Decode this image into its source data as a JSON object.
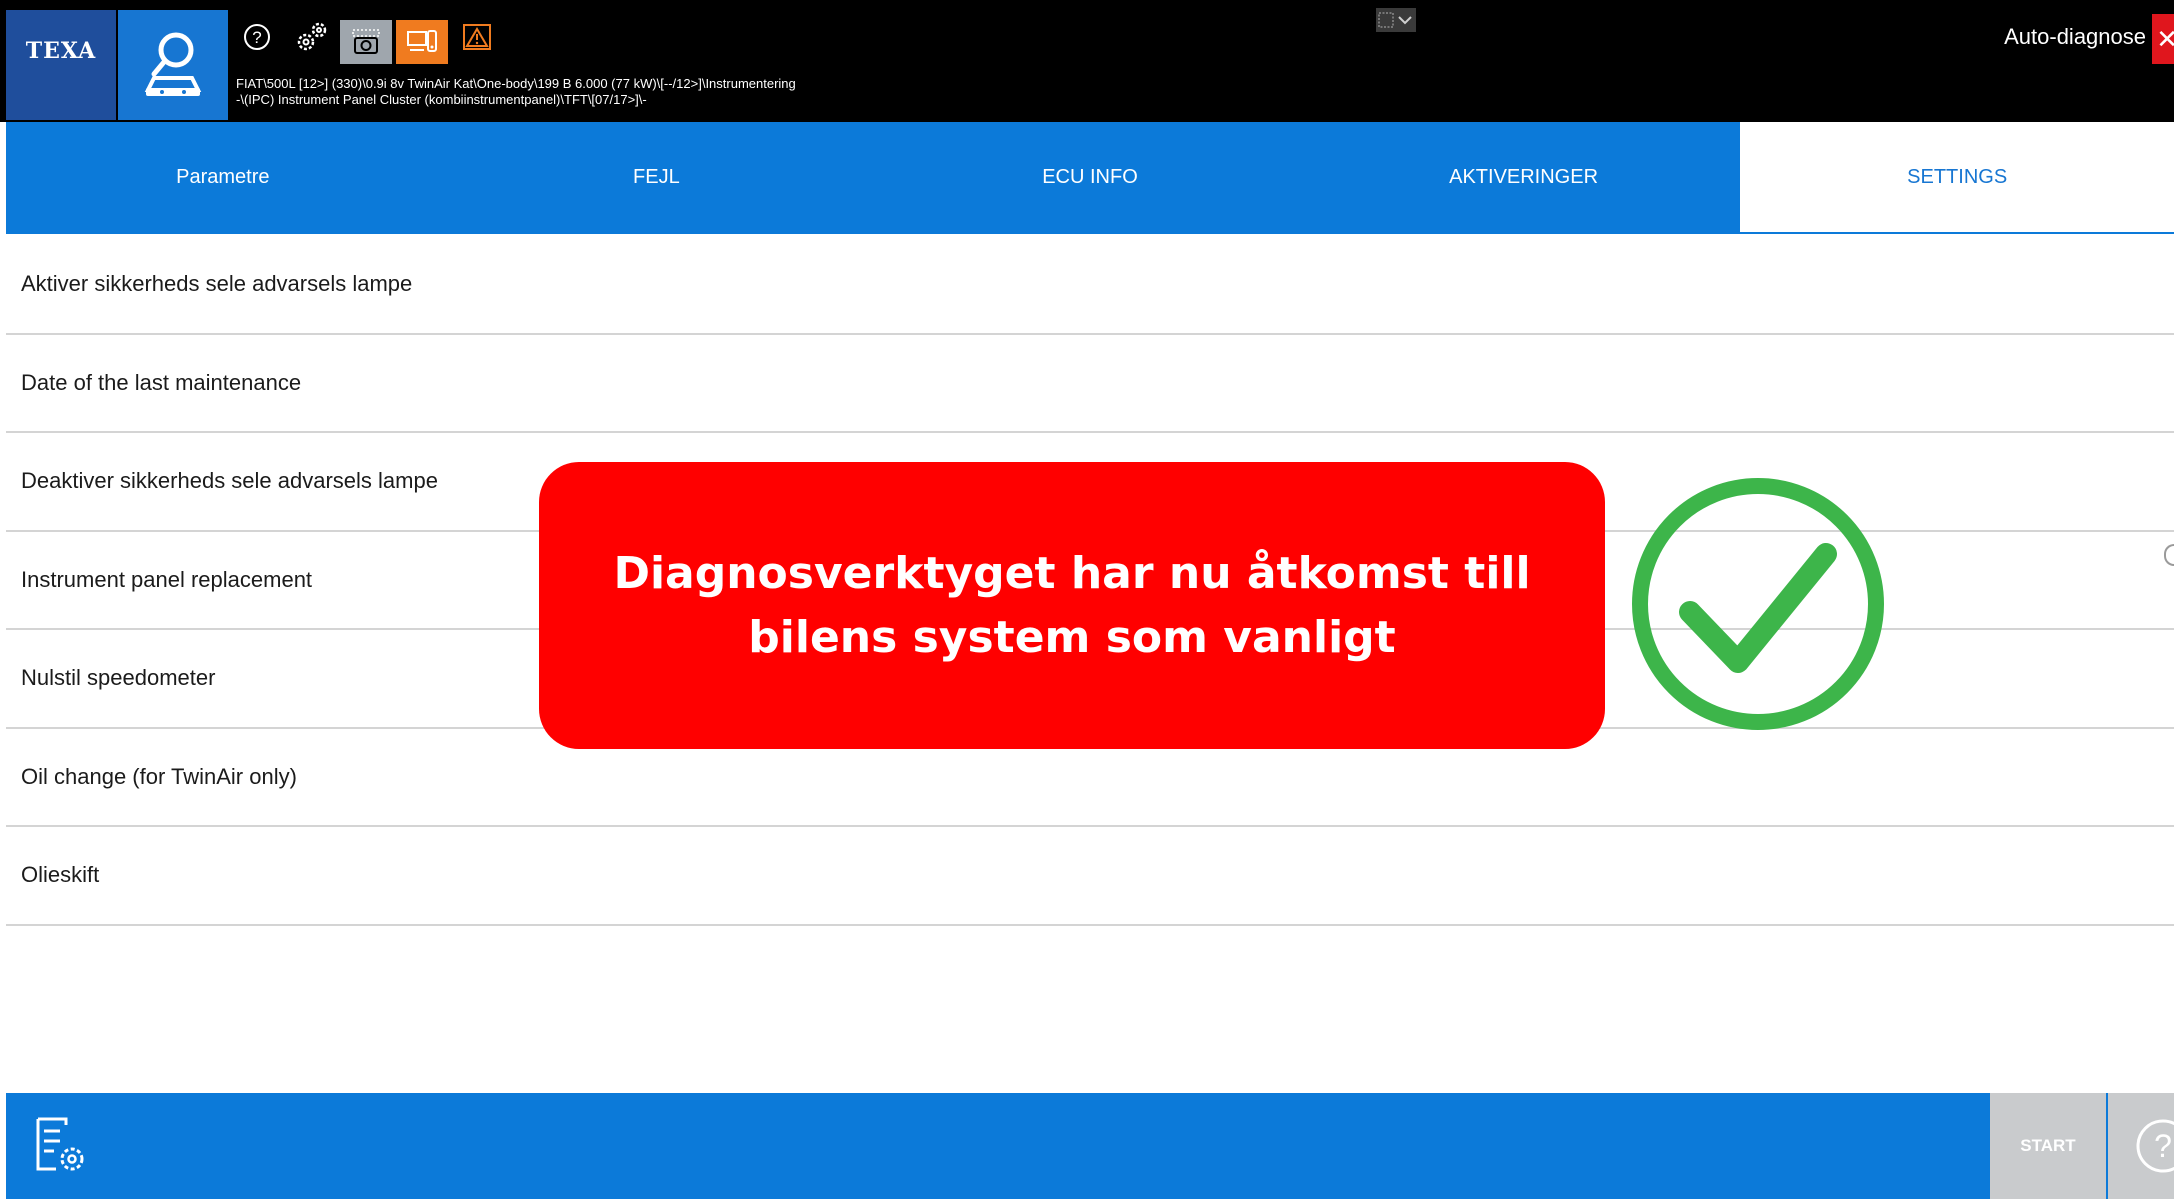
{
  "header": {
    "logo_text": "TEXA",
    "breadcrumb_line1": "FIAT\\500L [12>] (330)\\0.9i 8v TwinAir Kat\\One-body\\199 B 6.000 (77 kW)\\[--/12>]\\Instrumentering",
    "breadcrumb_line2": "-\\(IPC) Instrument Panel Cluster (kombiinstrumentpanel)\\TFT\\[07/17>]\\-",
    "title": "Auto-diagnose",
    "close_glyph": "✕"
  },
  "tabs": [
    {
      "label": "Parametre",
      "active": false
    },
    {
      "label": "FEJL",
      "active": false
    },
    {
      "label": "ECU INFO",
      "active": false
    },
    {
      "label": "AKTIVERINGER",
      "active": false
    },
    {
      "label": "SETTINGS",
      "active": true
    }
  ],
  "settings_items": [
    {
      "label": "Aktiver sikkerheds sele advarsels lampe"
    },
    {
      "label": "Date of the last maintenance"
    },
    {
      "label": "Deaktiver sikkerheds sele advarsels lampe"
    },
    {
      "label": "Instrument panel replacement"
    },
    {
      "label": "Nulstil speedometer"
    },
    {
      "label": "Oil change (for TwinAir only)"
    },
    {
      "label": "Olieskift"
    }
  ],
  "callout": {
    "text": "Diagnosverktyget har nu åtkomst till bilens system som vanligt"
  },
  "footer": {
    "start_label": "START"
  },
  "colors": {
    "brand_blue": "#0c7ad9",
    "callout_red": "#ff0000",
    "check_green": "#3db54a",
    "header_black": "#000000"
  },
  "icons": {
    "autodiag": "magnifier-car-icon",
    "help": "question-circle-icon",
    "settings": "gears-icon",
    "screenshot": "camera-icon",
    "device": "device-link-icon",
    "warning": "warning-triangle-icon",
    "check": "check-circle-icon",
    "settings_list": "list-gear-icon"
  }
}
